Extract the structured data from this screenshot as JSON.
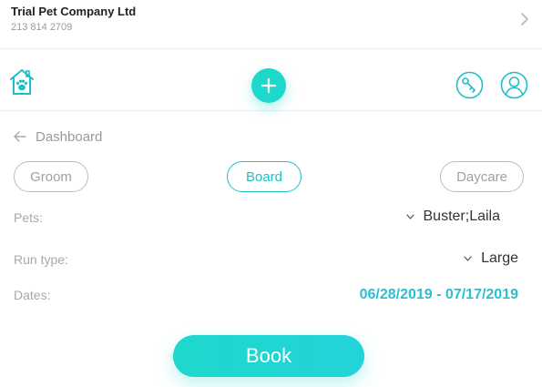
{
  "company": {
    "name": "Trial Pet Company Ltd",
    "phone": "213 814 2709"
  },
  "navigation": {
    "back_label": "Dashboard"
  },
  "service_tabs": [
    {
      "label": "Groom",
      "selected": false
    },
    {
      "label": "Board",
      "selected": true
    },
    {
      "label": "Daycare",
      "selected": false
    }
  ],
  "form": {
    "pets": {
      "label": "Pets:",
      "value": "Buster;Laila"
    },
    "run_type": {
      "label": "Run type:",
      "value": "Large"
    },
    "dates": {
      "label": "Dates:",
      "value": "06/28/2019 - 07/17/2019"
    }
  },
  "actions": {
    "book_label": "Book"
  },
  "icons": {
    "home": "house-paw-icon",
    "add": "plus-icon",
    "key": "key-icon",
    "profile": "user-icon",
    "back": "arrow-left-icon",
    "chevron": "chevron-right-icon",
    "caret": "chevron-down-icon"
  },
  "colors": {
    "accent": "#1ed8cc",
    "accent_text": "#1fbfc8",
    "dates_text": "#2bbfd2",
    "muted_text": "#a8a8a8"
  }
}
